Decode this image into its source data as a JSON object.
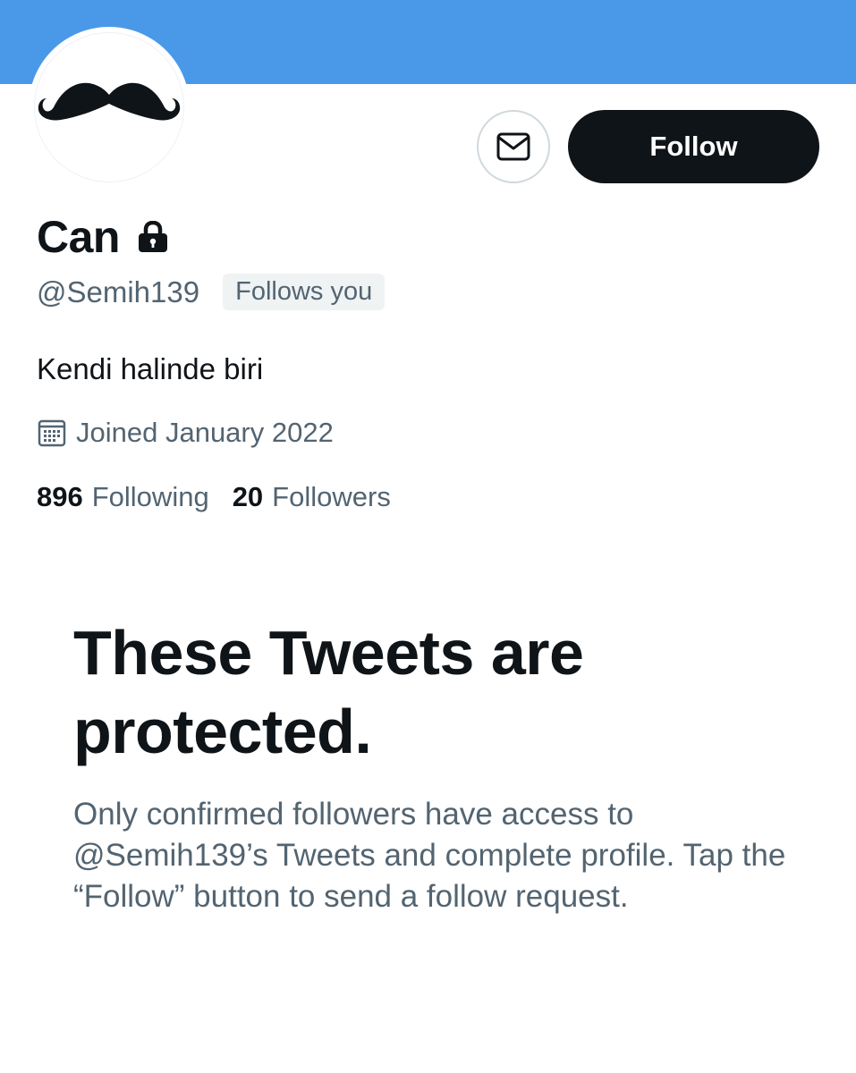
{
  "colors": {
    "banner": "#4a99e9",
    "primary_text": "#0f1419",
    "secondary_text": "#536471",
    "button_dark": "#0f1419",
    "badge_bg": "#eff3f4"
  },
  "header": {
    "message_icon": "envelope-icon",
    "follow_label": "Follow"
  },
  "profile": {
    "avatar_icon": "mustache-icon",
    "name": "Can",
    "protected_icon": "lock-icon",
    "handle": "@Semih139",
    "follows_you": "Follows you",
    "bio": "Kendi halinde biri",
    "joined_icon": "calendar-icon",
    "joined": "Joined January 2022",
    "following_count": "896",
    "following_label": "Following",
    "followers_count": "20",
    "followers_label": "Followers"
  },
  "protected_notice": {
    "title": "These Tweets are protected.",
    "description": "Only confirmed followers have access to @Semih139’s Tweets and complete profile. Tap the “Follow” button to send a follow request."
  }
}
